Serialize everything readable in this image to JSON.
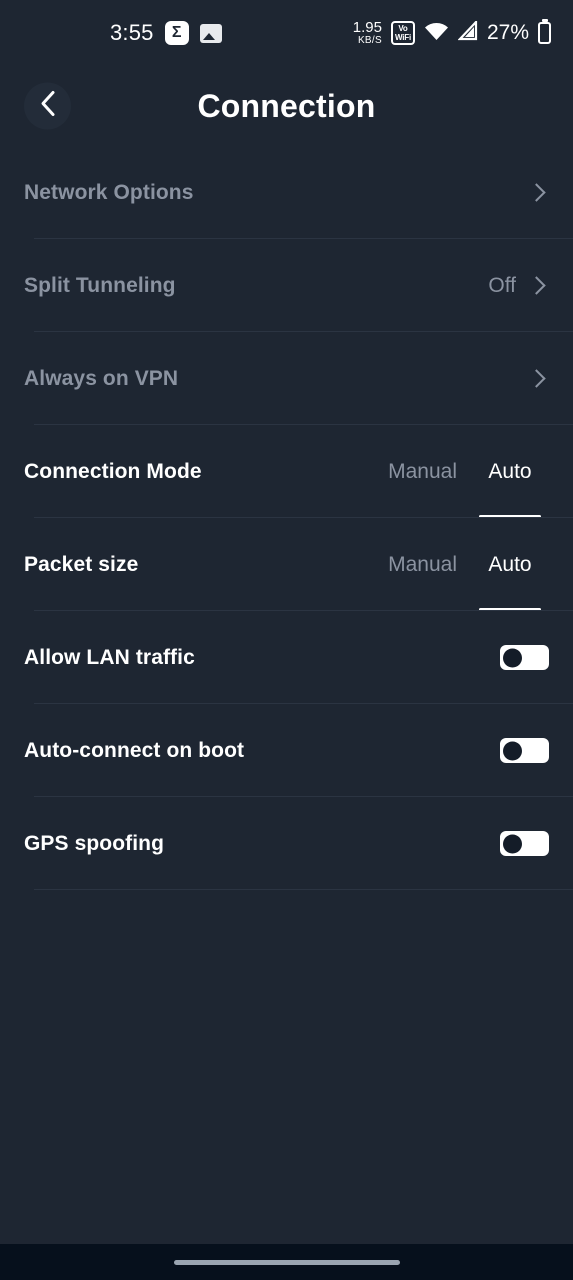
{
  "status_bar": {
    "time": "3:55",
    "sigma_icon_glyph": "Σ",
    "image_icon_name": "image-icon",
    "data_rate_value": "1.95",
    "data_rate_unit": "KB/S",
    "vowifi_line1": "Vo",
    "vowifi_line2": "WiFi",
    "battery_percent": "27%"
  },
  "header": {
    "title": "Connection",
    "back_icon": "chevron-left-icon"
  },
  "settings": {
    "rows": [
      {
        "label": "Network Options",
        "type": "navigation",
        "value": "",
        "enabled": false
      },
      {
        "label": "Split Tunneling",
        "type": "navigation",
        "value": "Off",
        "enabled": false
      },
      {
        "label": "Always on VPN",
        "type": "navigation",
        "value": "",
        "enabled": false
      },
      {
        "label": "Connection Mode",
        "type": "segmented",
        "options": [
          "Manual",
          "Auto"
        ],
        "selected": "Auto",
        "enabled": true
      },
      {
        "label": "Packet size",
        "type": "segmented",
        "options": [
          "Manual",
          "Auto"
        ],
        "selected": "Auto",
        "enabled": true
      },
      {
        "label": "Allow LAN traffic",
        "type": "toggle",
        "checked": false,
        "enabled": true
      },
      {
        "label": "Auto-connect on boot",
        "type": "toggle",
        "checked": false,
        "enabled": true
      },
      {
        "label": "GPS spoofing",
        "type": "toggle",
        "checked": false,
        "enabled": true
      }
    ]
  },
  "colors": {
    "background": "#1e2632",
    "text_primary": "#ffffff",
    "text_muted": "#8b93a1",
    "divider": "#2b3442",
    "toggle_track": "#ffffff",
    "toggle_knob": "#141c28",
    "navbar_background": "#06101c"
  }
}
